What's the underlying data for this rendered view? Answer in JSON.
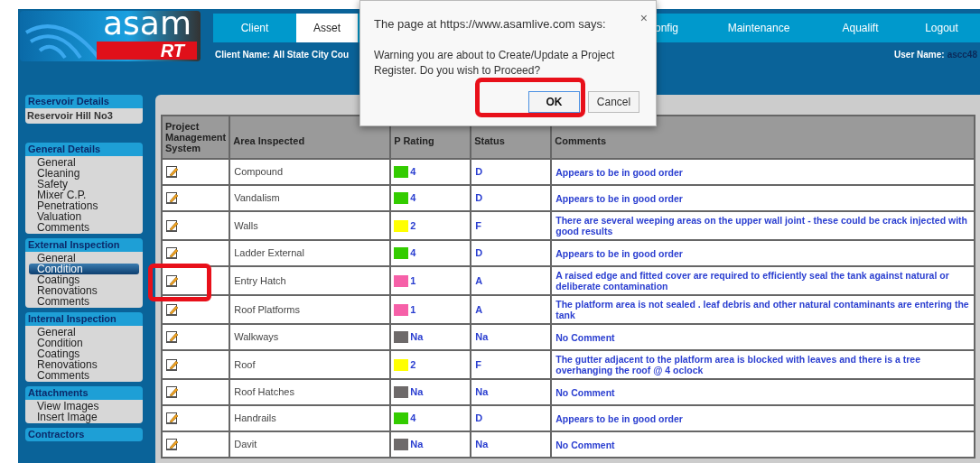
{
  "logo": {
    "wordmark": "asam",
    "badge": "RT"
  },
  "nav_tabs": [
    {
      "label": "Client",
      "selected": false
    },
    {
      "label": "Asset",
      "selected": true
    },
    {
      "label": "onfig",
      "selected": false
    },
    {
      "label": "Maintenance",
      "selected": false
    },
    {
      "label": "Aqualift",
      "selected": false
    },
    {
      "label": "Logout",
      "selected": false
    }
  ],
  "client_name": {
    "label": "Client Name:",
    "value": "All State City Cou"
  },
  "user_name": {
    "label": "User Name:",
    "value": "ascc48"
  },
  "sidebar": [
    {
      "title": "Reservoir Details",
      "kind": "info",
      "items": [
        {
          "label": "Reservoir Hill No3",
          "selected": false
        }
      ]
    },
    {
      "title": "General Details",
      "kind": "menu",
      "items": [
        {
          "label": "General",
          "selected": false
        },
        {
          "label": "Cleaning",
          "selected": false
        },
        {
          "label": "Safety",
          "selected": false
        },
        {
          "label": "Mixer C.P.",
          "selected": false
        },
        {
          "label": "Penetrations",
          "selected": false
        },
        {
          "label": "Valuation",
          "selected": false
        },
        {
          "label": "Comments",
          "selected": false
        }
      ]
    },
    {
      "title": "External Inspection",
      "kind": "menu",
      "items": [
        {
          "label": "General",
          "selected": false
        },
        {
          "label": "Condition",
          "selected": true
        },
        {
          "label": "Coatings",
          "selected": false
        },
        {
          "label": "Renovations",
          "selected": false
        },
        {
          "label": "Comments",
          "selected": false
        }
      ]
    },
    {
      "title": "Internal Inspection",
      "kind": "menu",
      "items": [
        {
          "label": "General",
          "selected": false
        },
        {
          "label": "Condition",
          "selected": false
        },
        {
          "label": "Coatings",
          "selected": false
        },
        {
          "label": "Renovations",
          "selected": false
        },
        {
          "label": "Comments",
          "selected": false
        }
      ]
    },
    {
      "title": "Attachments",
      "kind": "menu",
      "items": [
        {
          "label": "View Images",
          "selected": false
        },
        {
          "label": "Insert Image",
          "selected": false
        }
      ]
    },
    {
      "title": "Contractors",
      "kind": "header"
    }
  ],
  "table": {
    "columns": [
      "Project Management System",
      "Area Inspected",
      "P Rating",
      "Status",
      "Comments"
    ],
    "rows": [
      {
        "area": "Compound",
        "rating": "4",
        "color": "#33cc00",
        "status": "D",
        "comment": "Appears to be in good order",
        "highlighted": false
      },
      {
        "area": "Vandalism",
        "rating": "4",
        "color": "#33cc00",
        "status": "D",
        "comment": "Appears to be in good order",
        "highlighted": false
      },
      {
        "area": "Walls",
        "rating": "2",
        "color": "#ffff00",
        "status": "F",
        "comment": "There are several weeping areas on the upper wall joint - these could be crack injected with good results",
        "highlighted": false
      },
      {
        "area": "Ladder External",
        "rating": "4",
        "color": "#33cc00",
        "status": "D",
        "comment": "Appears to be in good order",
        "highlighted": false
      },
      {
        "area": "Entry Hatch",
        "rating": "1",
        "color": "#f660a8",
        "status": "A",
        "comment": "A raised edge and fitted cover are required to efficiently seal the tank against natural or deliberate contamination",
        "highlighted": true
      },
      {
        "area": "Roof Platforms",
        "rating": "1",
        "color": "#f660a8",
        "status": "A",
        "comment": "The platform area is not sealed . leaf debris and other natural contaminants are entering the tank",
        "highlighted": false
      },
      {
        "area": "Walkways",
        "rating": "Na",
        "color": "#6e6a6a",
        "status": "Na",
        "comment": "No Comment",
        "highlighted": false
      },
      {
        "area": "Roof",
        "rating": "2",
        "color": "#ffff00",
        "status": "F",
        "comment": "The gutter adjacent to the platform area is blocked with leaves and there is a tree overhanging the roof @ 4 oclock",
        "highlighted": false
      },
      {
        "area": "Roof Hatches",
        "rating": "Na",
        "color": "#6e6a6a",
        "status": "Na",
        "comment": "No Comment",
        "highlighted": false
      },
      {
        "area": "Handrails",
        "rating": "4",
        "color": "#33cc00",
        "status": "D",
        "comment": "Appears to be in good order",
        "highlighted": false
      },
      {
        "area": "Davit",
        "rating": "Na",
        "color": "#6e6a6a",
        "status": "Na",
        "comment": "No Comment",
        "highlighted": false
      }
    ]
  },
  "dialog": {
    "title": "The page at https://www.asamlive.com says:",
    "close": "×",
    "message": "Warning you are about to Create/Update a Project Register. Do you wish to Proceed?",
    "buttons": [
      {
        "label": "OK",
        "selected": true,
        "highlighted": true
      },
      {
        "label": "Cancel",
        "selected": false,
        "highlighted": false
      }
    ]
  }
}
